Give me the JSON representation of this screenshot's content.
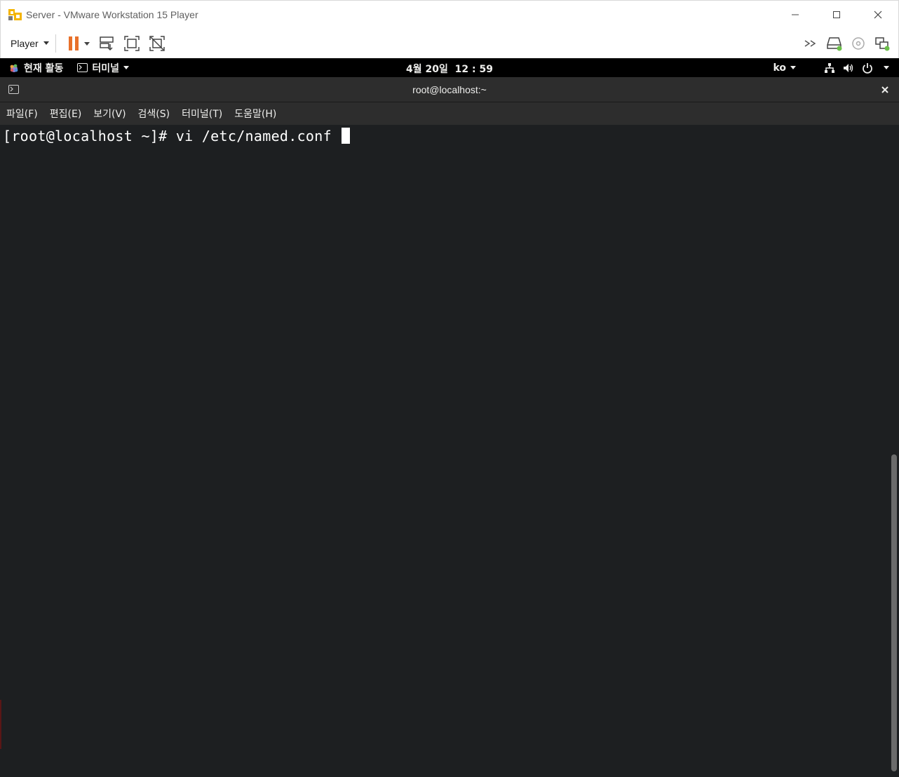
{
  "window": {
    "title": "Server - VMware Workstation 15 Player",
    "controls": [
      "minimize-icon",
      "maximize-icon",
      "close-icon"
    ]
  },
  "toolbar": {
    "player_label": "Player",
    "left_icons": [
      "pause-icon",
      "send-ctrl-alt-del-icon",
      "fullscreen-icon",
      "unity-icon"
    ],
    "right_icons": [
      "more-chevron-icon",
      "hard-disk-icon",
      "cd-dvd-icon",
      "network-adapter-icon"
    ],
    "accent_color": "#e8702a"
  },
  "gnome": {
    "activities_label": "현재 활동",
    "app_menu_label": "터미널",
    "clock": "4월 20일  12 : 59",
    "language": "ko",
    "tray_icons": [
      "network-wired-icon",
      "volume-icon",
      "power-icon"
    ]
  },
  "terminal": {
    "title": "root@localhost:~",
    "menu": [
      "파일(F)",
      "편집(E)",
      "보기(V)",
      "검색(S)",
      "터미널(T)",
      "도움말(H)"
    ],
    "prompt_line": "[root@localhost ~]# vi /etc/named.conf ",
    "background": "#1d1f21"
  }
}
